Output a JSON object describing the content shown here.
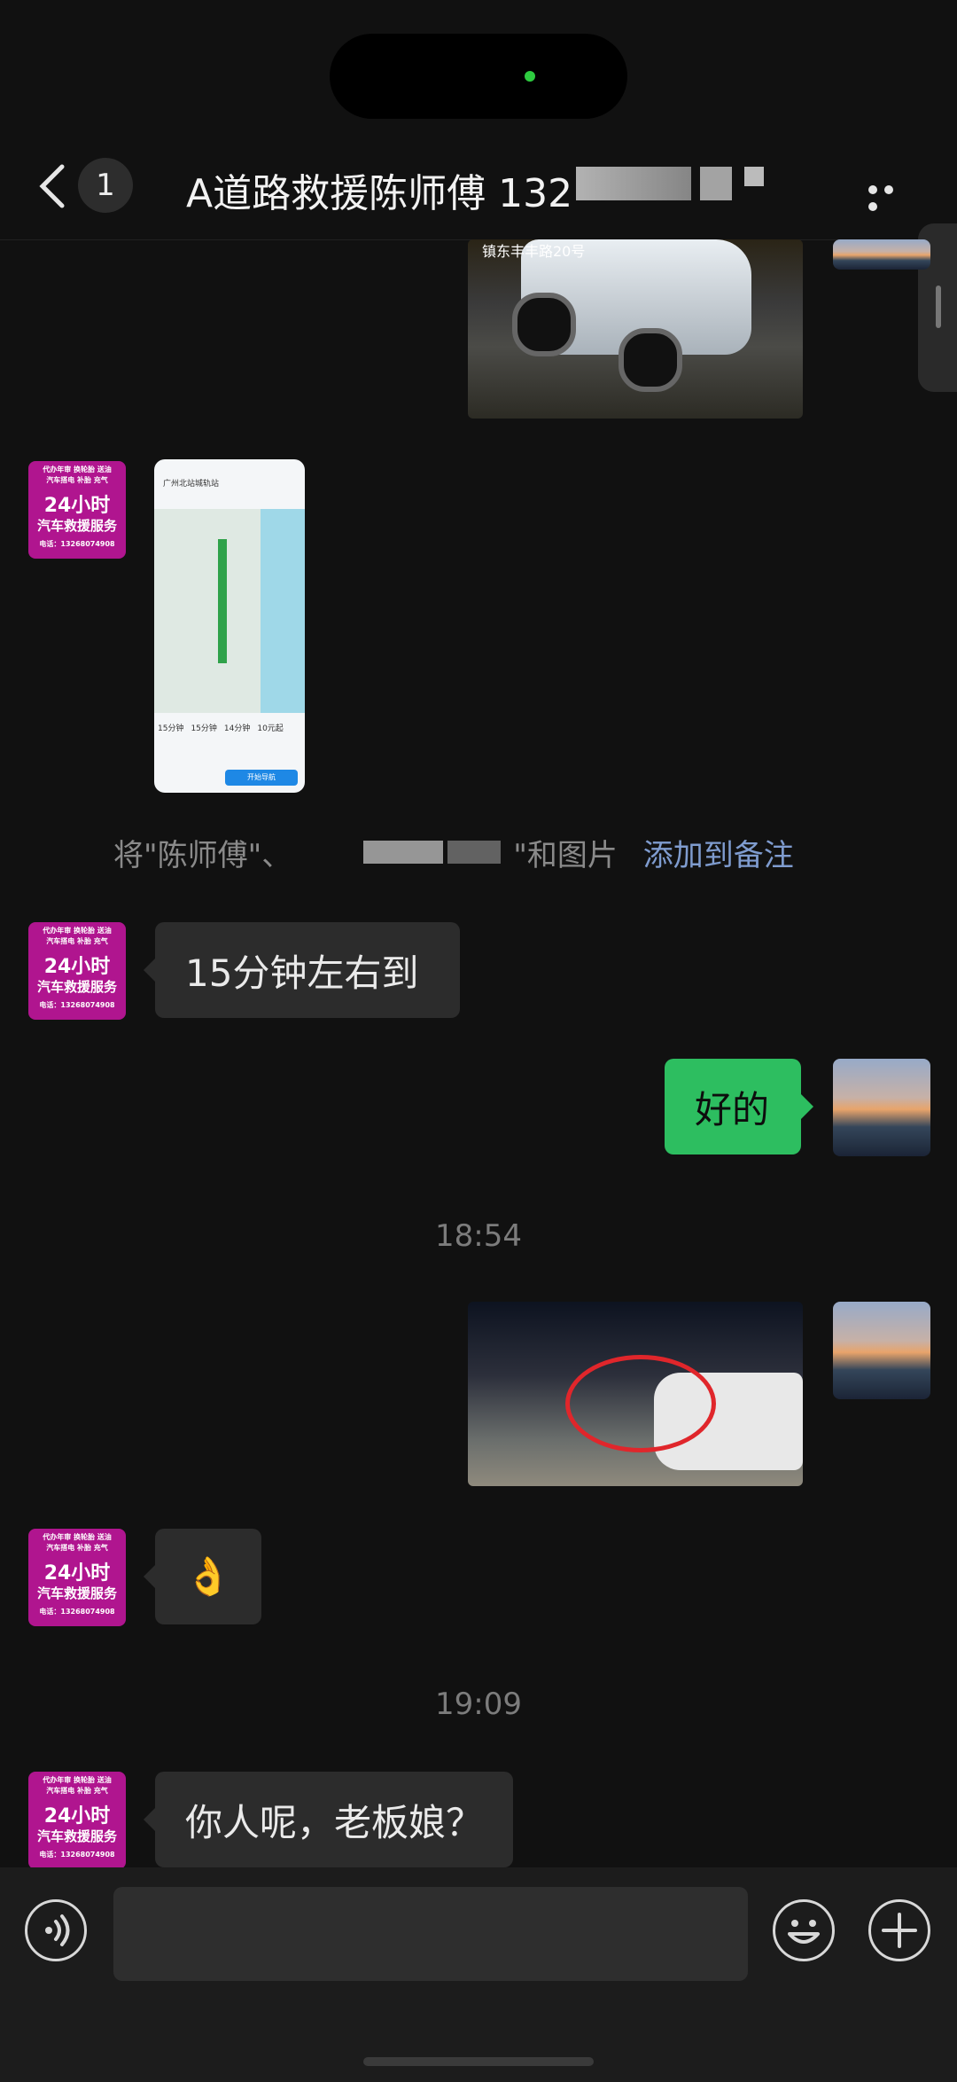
{
  "header": {
    "back_icon": "chevron-left-icon",
    "unread_count": "1",
    "title": "A道路救援陈师傅 132",
    "more_icon": "ellipsis-icon"
  },
  "contact_avatar": {
    "lines": [
      "代办年审 换轮胎 送油",
      "汽车搭电 补胎 充气",
      "24小时",
      "汽车救援服务",
      "电话：13268074908"
    ]
  },
  "car_photo": {
    "caption": "镇东丰丰路20号"
  },
  "notice": {
    "prefix": "将\"陈师傅\"、",
    "middle": "\"和图片",
    "link": "添加到备注"
  },
  "messages": [
    {
      "side": "in",
      "text": "15分钟左右到"
    },
    {
      "side": "out",
      "text": "好的"
    },
    {
      "side": "in",
      "text": "👌"
    },
    {
      "side": "in",
      "text": "你人呢，老板娘？"
    }
  ],
  "times": [
    "18:54",
    "19:09"
  ],
  "map_screenshot": {
    "destination": "广州北站城轨站",
    "options": [
      "15分钟",
      "15分钟",
      "14分钟",
      "10元起"
    ],
    "start_button": "开始导航"
  },
  "input": {
    "voice_icon": "voice-icon",
    "emoji_icon": "emoji-icon",
    "plus_icon": "plus-icon",
    "value": ""
  },
  "colors": {
    "background": "#111111",
    "incoming_bubble": "#2c2c2c",
    "outgoing_bubble": "#2dbe60",
    "link": "#7f9ccf"
  }
}
